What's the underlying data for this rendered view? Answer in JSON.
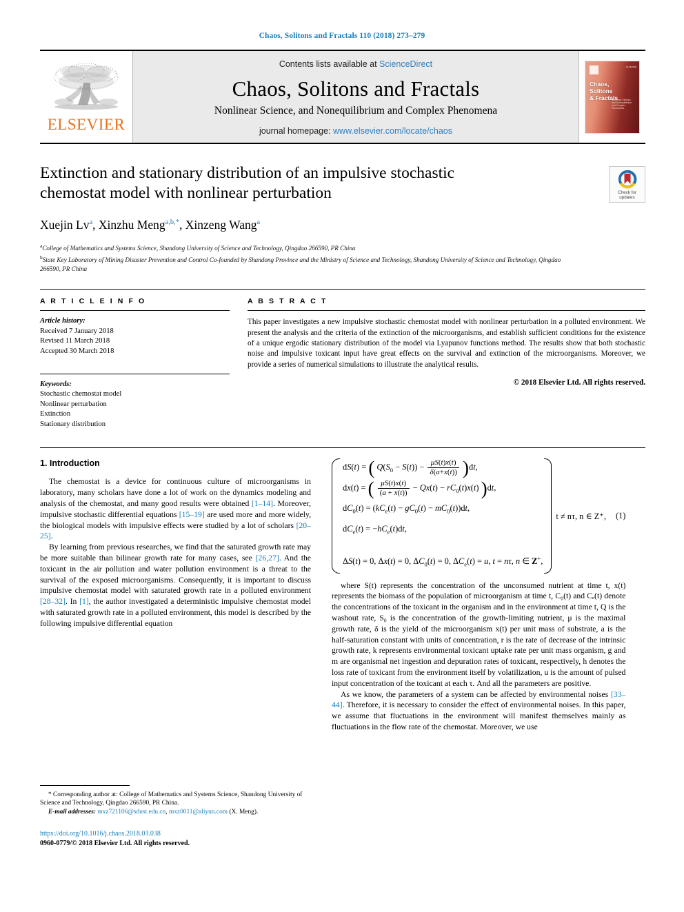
{
  "running_head": "Chaos, Solitons and Fractals 110 (2018) 273–279",
  "masthead": {
    "publisher_name": "ELSEVIER",
    "contents_prefix": "Contents lists available at ",
    "contents_link": "ScienceDirect",
    "journal_title": "Chaos, Solitons and Fractals",
    "journal_subtitle": "Nonlinear Science, and Nonequilibrium and Complex Phenomena",
    "homepage_prefix": "journal homepage: ",
    "homepage_url": "www.elsevier.com/locate/chaos",
    "cover_title_line1": "Chaos,",
    "cover_title_line2": "Solitons",
    "cover_title_line3": "& Fractals",
    "cover_blurb": "Nonlinear Science, and Nonequilibrium and Complex Phenomena",
    "cover_corner": "ELSEVIER"
  },
  "article": {
    "title": "Extinction and stationary distribution of an impulsive stochastic chemostat model with nonlinear perturbation",
    "authors": [
      {
        "name": "Xuejin Lv",
        "marks": "a",
        "star": false
      },
      {
        "name": "Xinzhu Meng",
        "marks": "a,b,",
        "star": true
      },
      {
        "name": "Xinzeng Wang",
        "marks": "a",
        "star": false
      }
    ],
    "affiliations": [
      {
        "mark": "a",
        "text": "College of Mathematics and Systems Science, Shandong University of Science and Technology, Qingdao 266590, PR China"
      },
      {
        "mark": "b",
        "text": "State Key Laboratory of Mining Disaster Prevention and Control Co-founded by Shandong Province and the Ministry of Science and Technology, Shandong University of Science and Technology, Qingdao 266590, PR China"
      }
    ],
    "crossmark_label_line1": "Check for",
    "crossmark_label_line2": "updates"
  },
  "info": {
    "heading": "A R T I C L E   I N F O",
    "history_label": "Article history:",
    "history": [
      "Received 7 January 2018",
      "Revised 11 March 2018",
      "Accepted 30 March 2018"
    ],
    "keywords_label": "Keywords:",
    "keywords": [
      "Stochastic chemostat model",
      "Nonlinear perturbation",
      "Extinction",
      "Stationary distribution"
    ]
  },
  "abstract": {
    "heading": "A B S T R A C T",
    "text": "This paper investigates a new impulsive stochastic chemostat model with nonlinear perturbation in a polluted environment. We present the analysis and the criteria of the extinction of the microorganisms, and establish sufficient conditions for the existence of a unique ergodic stationary distribution of the model via Lyapunov functions method. The results show that both stochastic noise and impulsive toxicant input have great effects on the survival and extinction of the microorganisms. Moreover, we provide a series of numerical simulations to illustrate the analytical results.",
    "rights": "© 2018 Elsevier Ltd. All rights reserved."
  },
  "sections": {
    "intro_heading": "1. Introduction",
    "intro_p1_a": "The chemostat is a device for continuous culture of microorganisms in laboratory, many scholars have done a lot of work on the dynamics modeling and analysis of the chemostat, and many good results were obtained ",
    "intro_p1_r1": "[1–14]",
    "intro_p1_b": ". Moreover, impulsive stochastic differential equations ",
    "intro_p1_r2": "[15–19]",
    "intro_p1_c": " are used more and more widely, the biological models with impulsive effects were studied by a lot of scholars ",
    "intro_p1_r3": "[20–25]",
    "intro_p1_d": ".",
    "intro_p2_a": "By learning from previous researches, we find that the saturated growth rate may be more suitable than bilinear growth rate for many cases, see ",
    "intro_p2_r1": "[26,27]",
    "intro_p2_b": ". And the toxicant in the air pollution and water pollution environment is a threat to the survival of the exposed microorganisms. Consequently, it is important to discuss impulsive chemostat model with saturated growth rate in a polluted environment ",
    "intro_p2_r2": "[28–32]",
    "intro_p2_c": ". In ",
    "intro_p2_r3": "[1]",
    "intro_p2_d": ", the author investigated a deterministic impulsive chemostat model with saturated growth rate in a polluted environment, this model is described by the following impulsive differential equation"
  },
  "equation": {
    "number": "(1)",
    "condition_top": "t ≠ nτ, n ∈ Z⁺,",
    "row1": "dS(t) = ( Q(S₀ − S(t)) − μS(t)x(t)/δ(a+x(t)) )dt,",
    "row2": "dx(t) = ( μS(t)x(t)/(a + x(t)) − Qx(t) − rC₀(t)x(t) )dt,",
    "row3": "dC₀(t) = (kCₑ(t) − gC₀(t) − mC₀(t))dt,",
    "row4": "dCₑ(t) = −hCₑ(t)dt,",
    "row5": "ΔS(t) = 0, Δx(t) = 0, ΔC₀(t) = 0, ΔCₑ(t) = u, t = nτ, n ∈ Z⁺,"
  },
  "where_text": {
    "p1": "where S(t) represents the concentration of the unconsumed nutrient at time t, x(t) represents the biomass of the population of microorganism at time t, C₀(t) and Cₑ(t) denote the concentrations of the toxicant in the organism and in the environment at time t, Q is the washout rate, S₀ is the concentration of the growth-limiting nutrient, μ is the maximal growth rate, δ is the yield of the microorganism x(t) per unit mass of substrate, a is the half-saturation constant with units of concentration, r is the rate of decrease of the intrinsic growth rate, k represents environmental toxicant uptake rate per unit mass organism, g and m are organismal net ingestion and depuration rates of toxicant, respectively, h denotes the loss rate of toxicant from the environment itself by volatilization, u is the amount of pulsed input concentration of the toxicant at each τ. And all the parameters are positive.",
    "p2_a": "As we know, the parameters of a system can be affected by environmental noises ",
    "p2_r1": "[33–44]",
    "p2_b": ". Therefore, it is necessary to consider the effect of environmental noises. In this paper, we assume that fluctuations in the environment will manifest themselves mainly as fluctuations in the flow rate of the chemostat. Moreover, we use"
  },
  "footer": {
    "corr_star": "*",
    "corr_text": " Corresponding author at: College of Mathematics and Systems Science, Shandong University of Science and Technology, Qingdao 266590, PR China.",
    "email_label": "E-mail addresses:",
    "email1": "mxz721106@sdust.edu.cn",
    "email2": "mxz0011@aliyun.com",
    "email_attrib": " (X. Meng).",
    "doi": "https://doi.org/10.1016/j.chaos.2018.03.038",
    "issn_line": "0960-0779/© 2018 Elsevier Ltd. All rights reserved."
  },
  "colors": {
    "link": "#1a7db6",
    "elsevier_orange": "#E9711C",
    "masthead_bg": "#eaeaea"
  }
}
